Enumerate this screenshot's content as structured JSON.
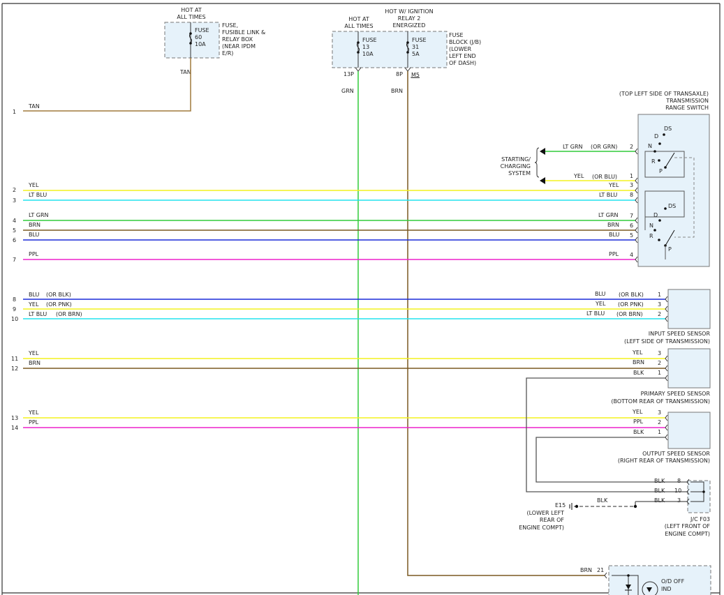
{
  "colors": {
    "TAN": "#a07a3c",
    "YEL": "#f4f21e",
    "LTBLU": "#22e3ee",
    "LTGRN": "#30cc3a",
    "BRN": "#7a5820",
    "BLU": "#1a2ad8",
    "PPL": "#ee22cc",
    "BLK": "#555555",
    "GRN": "#30cc3a"
  },
  "fuse_left": {
    "title": [
      "HOT AT",
      "ALL TIMES"
    ],
    "fuse": [
      "FUSE",
      "60",
      "10A"
    ],
    "desc": [
      "FUSE,",
      "FUSIBLE LINK &",
      "RELAY BOX",
      "(NEAR IPDM",
      "E/R)"
    ],
    "wire": "TAN"
  },
  "fuse_right": {
    "title_a": [
      "HOT AT",
      "ALL TIMES"
    ],
    "title_b": [
      "HOT W/ IGNITION",
      "RELAY 2",
      "ENERGIZED"
    ],
    "fuse_a": [
      "FUSE",
      "13",
      "10A"
    ],
    "fuse_b": [
      "FUSE",
      "31",
      "5A"
    ],
    "desc": [
      "FUSE",
      "BLOCK (J/B)",
      "(LOWER",
      "LEFT END",
      "OF DASH)"
    ],
    "pin_a": "13P",
    "pin_b": "8P",
    "conn": "M5",
    "wire_a": "GRN",
    "wire_b": "BRN"
  },
  "left_wires": [
    {
      "num": "1",
      "label": "TAN"
    },
    {
      "num": "2",
      "label": "YEL"
    },
    {
      "num": "3",
      "label": "LT BLU"
    },
    {
      "num": "4",
      "label": "LT GRN"
    },
    {
      "num": "5",
      "label": "BRN"
    },
    {
      "num": "6",
      "label": "BLU"
    },
    {
      "num": "7",
      "label": "PPL"
    },
    {
      "num": "8",
      "label": "BLU",
      "alt": "(OR BLK)"
    },
    {
      "num": "9",
      "label": "YEL",
      "alt": "(OR PNK)"
    },
    {
      "num": "10",
      "label": "LT BLU",
      "alt": "(OR BRN)"
    },
    {
      "num": "11",
      "label": "YEL"
    },
    {
      "num": "12",
      "label": "BRN"
    },
    {
      "num": "13",
      "label": "YEL"
    },
    {
      "num": "14",
      "label": "PPL"
    }
  ],
  "trs": {
    "title": [
      "(TOP LEFT SIDE OF TRANSAXLE)",
      "TRANSMISSION",
      "RANGE SWITCH"
    ],
    "upper": [
      "DS",
      "D",
      "N",
      "R",
      "P"
    ],
    "lower": [
      "DS",
      "D",
      "N",
      "R",
      "P"
    ],
    "pins": [
      {
        "label": "LT GRN",
        "alt": "(OR GRN)",
        "pin": "2"
      },
      {
        "label": "YEL",
        "alt": "(OR BLU)",
        "pin": "1"
      },
      {
        "label": "YEL",
        "pin": "3"
      },
      {
        "label": "LT BLU",
        "pin": "8"
      },
      {
        "label": "LT GRN",
        "pin": "7"
      },
      {
        "label": "BRN",
        "pin": "6"
      },
      {
        "label": "BLU",
        "pin": "5"
      },
      {
        "label": "PPL",
        "pin": "4"
      }
    ]
  },
  "starting": [
    "STARTING/",
    "CHARGING",
    "SYSTEM"
  ],
  "input_sensor": {
    "title": [
      "INPUT SPEED SENSOR",
      "(LEFT SIDE OF TRANSMISSION)"
    ],
    "pins": [
      {
        "label": "BLU",
        "alt": "(OR BLK)",
        "pin": "1"
      },
      {
        "label": "YEL",
        "alt": "(OR PNK)",
        "pin": "3"
      },
      {
        "label": "LT BLU",
        "alt": "(OR BRN)",
        "pin": "2"
      }
    ]
  },
  "primary_sensor": {
    "title": [
      "PRIMARY SPEED SENSOR",
      "(BOTTOM REAR OF TRANSMISSION)"
    ],
    "pins": [
      {
        "label": "YEL",
        "pin": "3"
      },
      {
        "label": "BRN",
        "pin": "2"
      },
      {
        "label": "BLK",
        "pin": "1"
      }
    ]
  },
  "output_sensor": {
    "title": [
      "OUTPUT SPEED SENSOR",
      "(RIGHT REAR OF TRANSMISSION)"
    ],
    "pins": [
      {
        "label": "YEL",
        "pin": "3"
      },
      {
        "label": "PPL",
        "pin": "2"
      },
      {
        "label": "BLK",
        "pin": "1"
      }
    ]
  },
  "jc": {
    "pins": [
      {
        "label": "BLK",
        "pin": "8"
      },
      {
        "label": "BLK",
        "pin": "10"
      },
      {
        "label": "BLK",
        "pin": "3"
      }
    ],
    "title": [
      "J/C F03",
      "(LEFT FRONT OF",
      "ENGINE COMPT)"
    ]
  },
  "ground": {
    "id": "E15",
    "desc": [
      "(LOWER LEFT",
      "REAR OF",
      "ENGINE COMPT)"
    ],
    "wire": "BLK"
  },
  "od": {
    "wire": "BRN",
    "pin": "21",
    "title": [
      "O/D OFF",
      "IND"
    ]
  }
}
